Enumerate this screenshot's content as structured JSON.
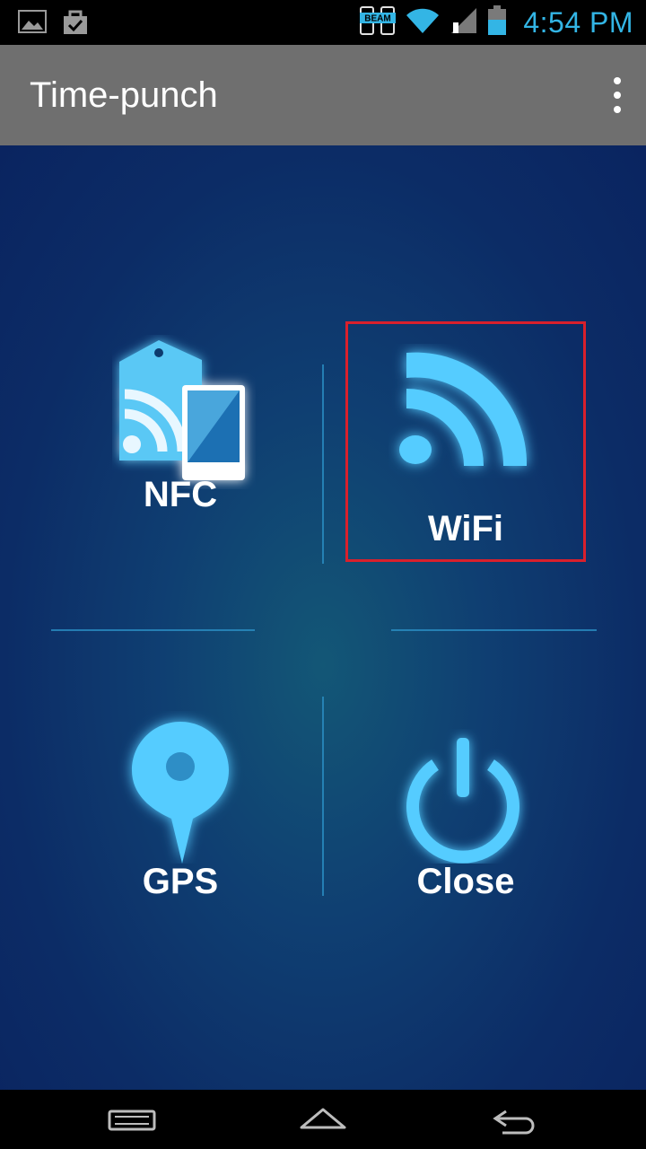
{
  "status_bar": {
    "time": "4:54 PM",
    "icons": [
      "gallery-notification-icon",
      "clipboard-check-notification-icon",
      "beam-icon",
      "wifi-signal-icon",
      "cell-signal-icon",
      "battery-icon"
    ],
    "beam_label": "BEAM"
  },
  "action_bar": {
    "title": "Time-punch",
    "overflow_icon": "more-vertical-icon"
  },
  "tiles": {
    "nfc": {
      "label": "NFC",
      "icon": "nfc-tag-icon"
    },
    "wifi": {
      "label": "WiFi",
      "icon": "wifi-broadcast-icon"
    },
    "gps": {
      "label": "GPS",
      "icon": "map-pin-icon"
    },
    "close": {
      "label": "Close",
      "icon": "power-icon"
    }
  },
  "nav_bar": {
    "buttons": [
      "recent-apps-icon",
      "home-icon",
      "back-icon"
    ]
  },
  "colors": {
    "accent": "#33b5e5",
    "icon_glow": "#55ccff",
    "action_bar": "#6f6f6f",
    "main_bg": "#0f3f72",
    "selection": "#d9202c"
  }
}
